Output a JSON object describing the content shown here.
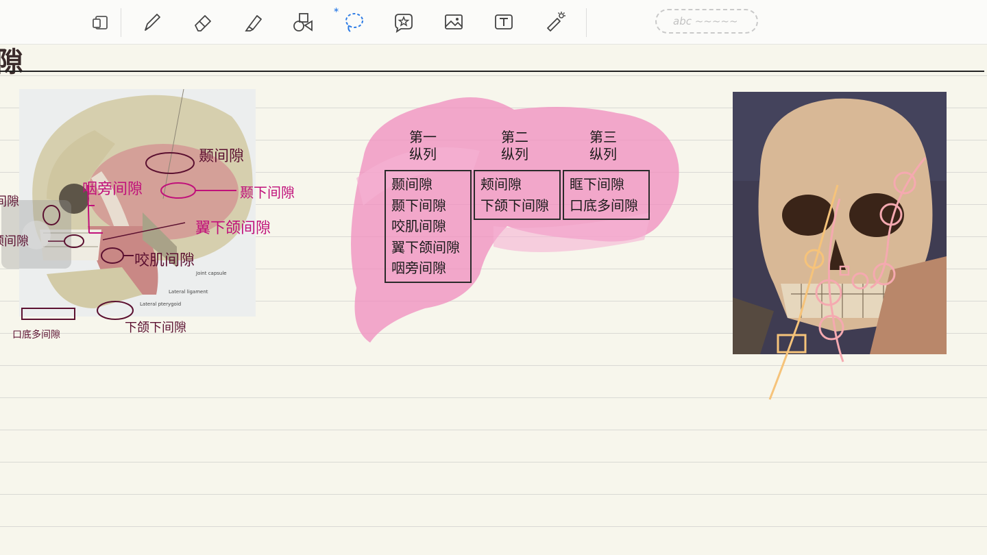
{
  "toolbar": {
    "tools": [
      {
        "name": "pages",
        "icon": "pages-icon"
      },
      {
        "name": "pen",
        "icon": "pen-icon"
      },
      {
        "name": "eraser",
        "icon": "eraser-icon"
      },
      {
        "name": "highlighter",
        "icon": "highlighter-icon"
      },
      {
        "name": "shapes",
        "icon": "shapes-icon"
      },
      {
        "name": "lasso",
        "icon": "lasso-icon"
      },
      {
        "name": "sticker",
        "icon": "sticker-icon"
      },
      {
        "name": "image",
        "icon": "image-icon"
      },
      {
        "name": "text",
        "icon": "text-icon"
      },
      {
        "name": "laser-pointer",
        "icon": "laser-pointer-icon"
      }
    ],
    "handwriting_hint": "abc ~~~~~",
    "bluetooth_symbol": "∗"
  },
  "page": {
    "heading_fragment": "隙"
  },
  "left_figure": {
    "printed_labels": [
      "Joint capsule",
      "Lateral ligament",
      "Lateral pterygoid"
    ],
    "annotations": {
      "temporal": "颞间隙",
      "infratemporal": "颞下间隙",
      "parapharyngeal": "咽旁间隙",
      "pterygomandibular": "翼下颌间隙",
      "masseter": "咬肌间隙",
      "submandibular": "下颌下间隙",
      "floor_of_mouth": "口底多间隙",
      "partial_1": "间隙",
      "partial_2": "颊间隙"
    }
  },
  "table": {
    "columns": [
      {
        "header": "第一\n纵列",
        "header_line1": "第一",
        "header_line2": "纵列",
        "items": [
          "颞间隙",
          "颞下间隙",
          "咬肌间隙",
          "翼下颌间隙",
          "咽旁间隙"
        ]
      },
      {
        "header_line1": "第二",
        "header_line2": "纵列",
        "items": [
          "颊间隙",
          "下颌下间隙"
        ]
      },
      {
        "header_line1": "第三",
        "header_line2": "纵列",
        "items": [
          "眶下间隙",
          "口底多间隙"
        ]
      }
    ]
  },
  "colors": {
    "highlight_pink": "#f08cbf",
    "annotation_magenta": "#c0107a",
    "annotation_maroon": "#5b1030",
    "sketch_orange": "#f6c37a",
    "sketch_pink": "#f5a9b0"
  }
}
